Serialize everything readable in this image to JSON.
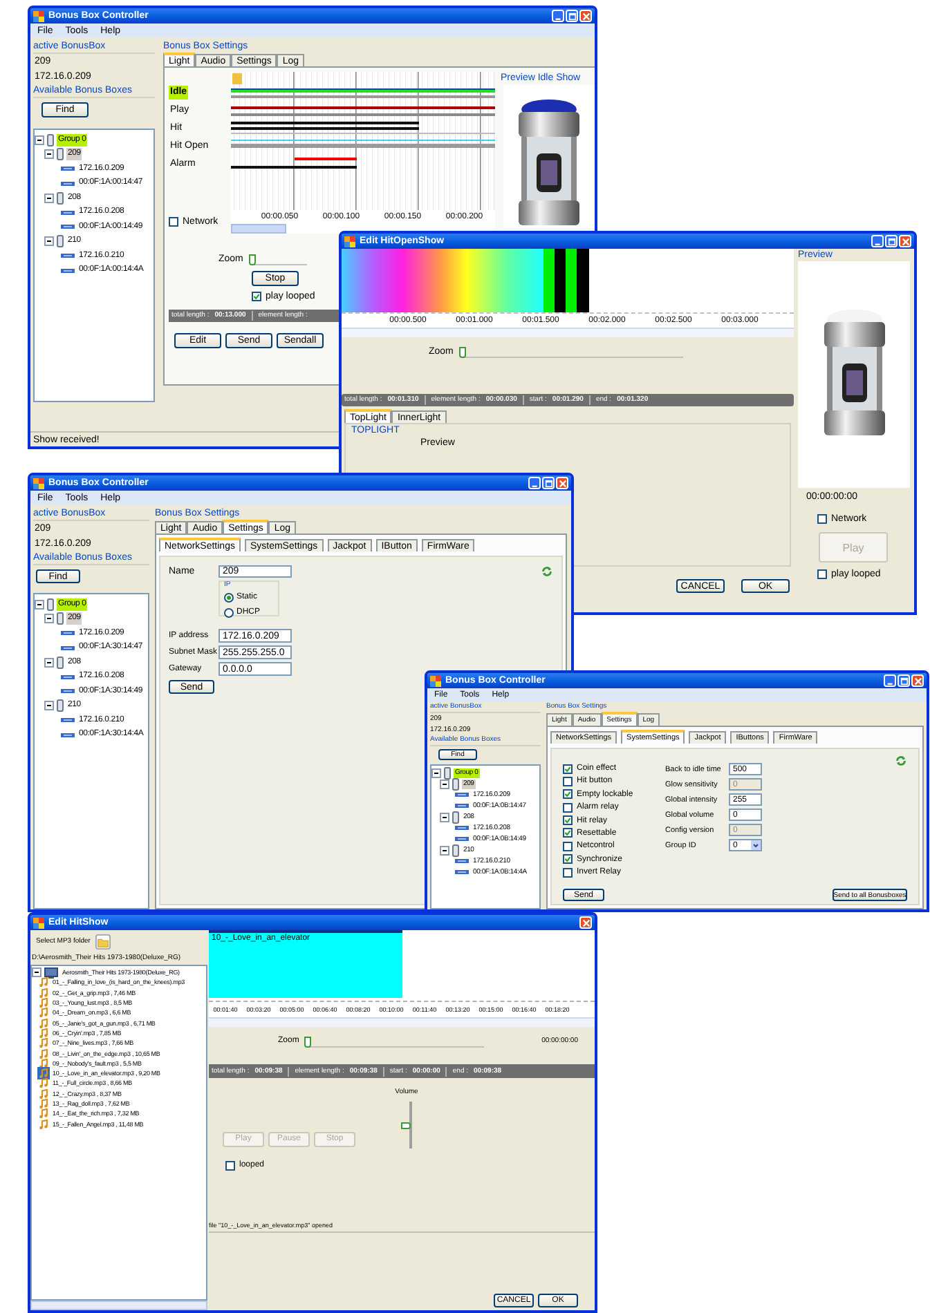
{
  "window_1": {
    "title": "Bonus Box Controller",
    "can_minimize": true,
    "menu": [
      "File",
      "Tools",
      "Help"
    ],
    "active_label": "active BonusBox",
    "active_name": "209",
    "active_ip": "172.16.0.209",
    "boxes_label": "Available Bonus Boxes",
    "find_button": "Find",
    "tree": [
      {
        "label": "Group 0",
        "kind": "group",
        "expanded": true,
        "highlighted": true,
        "children": [
          {
            "label": "209",
            "kind": "box",
            "expanded": true,
            "selected": true,
            "children": [
              {
                "label": "172.16.0.209"
              },
              {
                "label": "00:0F:1A:00:14:47"
              }
            ]
          },
          {
            "label": "208",
            "kind": "box",
            "expanded": true,
            "selected": false,
            "children": [
              {
                "label": "172.16.0.208"
              },
              {
                "label": "00:0F:1A:00:14:49"
              }
            ]
          },
          {
            "label": "210",
            "kind": "box",
            "expanded": true,
            "selected": false,
            "children": [
              {
                "label": "172.16.0.210"
              },
              {
                "label": "00:0F:1A:00:14:4A"
              }
            ]
          }
        ]
      }
    ],
    "settings_label": "Bonus Box Settings",
    "tabs": [
      {
        "label": "Light",
        "selected": true
      },
      {
        "label": "Audio",
        "selected": false
      },
      {
        "label": "Settings",
        "selected": false
      },
      {
        "label": "Log",
        "selected": false
      }
    ],
    "tracks": [
      {
        "label": "Idle",
        "highlighted": true
      },
      {
        "label": "Play",
        "highlighted": false
      },
      {
        "label": "Hit",
        "highlighted": false
      },
      {
        "label": "Hit Open",
        "highlighted": false
      },
      {
        "label": "Alarm",
        "highlighted": false
      }
    ],
    "network": {
      "label": "Network",
      "checked": false
    },
    "ticks": [
      "00:00.050",
      "00:00.100",
      "00:00.150",
      "00:00.200"
    ],
    "zoom": {
      "label": "Zoom",
      "level": 0
    },
    "stop_button": "Stop",
    "play_looped": {
      "label": "play looped",
      "checked": true
    },
    "status_fields": [
      {
        "label": "total length :",
        "value": "00:13.000"
      },
      {
        "label": "element length :"
      }
    ],
    "buttons": [
      "Edit",
      "Send",
      "Sendall"
    ],
    "preview_label": "Preview Idle Show",
    "status_bar": "Show received!"
  },
  "window_2": {
    "title": "Edit HitOpenShow",
    "can_minimize": true,
    "ticks": [
      "00:00.500",
      "00:01.000",
      "00:01.500",
      "00:02.000",
      "00:02.500",
      "00:03.000"
    ],
    "zoom": {
      "label": "Zoom",
      "level": 0
    },
    "status_fields": [
      {
        "label": "total length :",
        "value": "00:01.310"
      },
      {
        "label": "element length :",
        "value": "00:00.030"
      },
      {
        "label": "start :",
        "value": "00:01.290"
      },
      {
        "label": "end :",
        "value": "00:01.320"
      }
    ],
    "tabs": [
      {
        "label": "TopLight",
        "selected": true
      },
      {
        "label": "InnerLight",
        "selected": false
      }
    ],
    "group_label": "TOPLIGHT",
    "group_preview": "Preview",
    "preview_label": "Preview",
    "time": "00:00:00:00",
    "network": {
      "label": "Network",
      "checked": false
    },
    "play_button": {
      "label": "Play",
      "disabled": true
    },
    "play_looped": {
      "label": "play looped",
      "checked": false
    },
    "buttons": [
      "CANCEL",
      "OK"
    ]
  },
  "window_3": {
    "title": "Bonus Box Controller",
    "can_minimize": true,
    "menu": [
      "File",
      "Tools",
      "Help"
    ],
    "active_label": "active BonusBox",
    "active_name": "209",
    "active_ip": "172.16.0.209",
    "boxes_label": "Available Bonus Boxes",
    "find_button": "Find",
    "tree": [
      {
        "label": "Group 0",
        "kind": "group",
        "expanded": true,
        "highlighted": true,
        "children": [
          {
            "label": "209",
            "kind": "box",
            "expanded": true,
            "selected": true,
            "children": [
              {
                "label": "172.16.0.209"
              },
              {
                "label": "00:0F:1A:30:14:47"
              }
            ]
          },
          {
            "label": "208",
            "kind": "box",
            "expanded": true,
            "selected": false,
            "children": [
              {
                "label": "172.16.0.208"
              },
              {
                "label": "00:0F:1A:30:14:49"
              }
            ]
          },
          {
            "label": "210",
            "kind": "box",
            "expanded": true,
            "selected": false,
            "children": [
              {
                "label": "172.16.0.210"
              },
              {
                "label": "00:0F:1A:30:14:4A"
              }
            ]
          }
        ]
      }
    ],
    "settings_label": "Bonus Box Settings",
    "tabs": [
      {
        "label": "Light",
        "selected": false
      },
      {
        "label": "Audio",
        "selected": false
      },
      {
        "label": "Settings",
        "selected": true
      },
      {
        "label": "Log",
        "selected": false
      }
    ],
    "subtabs": [
      {
        "label": "NetworkSettings",
        "selected": true
      },
      {
        "label": "SystemSettings",
        "selected": false
      },
      {
        "label": "Jackpot",
        "selected": false
      },
      {
        "label": "IButton",
        "selected": false
      },
      {
        "label": "FirmWare",
        "selected": false
      }
    ],
    "name": {
      "label": "Name",
      "value": "209"
    },
    "ip_mode": {
      "label": "IP",
      "options": [
        {
          "label": "Static",
          "selected": true
        },
        {
          "label": "DHCP",
          "selected": false
        }
      ]
    },
    "addresses": [
      {
        "label": "IP address",
        "value": "172.16.0.209"
      },
      {
        "label": "Subnet Mask",
        "value": "255.255.255.0"
      },
      {
        "label": "Gateway",
        "value": "0.0.0.0"
      }
    ],
    "send_button": "Send"
  },
  "window_4": {
    "title": "Bonus Box Controller",
    "can_minimize": true,
    "menu": [
      "File",
      "Tools",
      "Help"
    ],
    "active_label": "active BonusBox",
    "active_name": "209",
    "active_ip": "172.16.0.209",
    "boxes_label": "Available Bonus Boxes",
    "find_button": "Find",
    "tree": [
      {
        "label": "Group 0",
        "kind": "group",
        "expanded": true,
        "highlighted": true,
        "children": [
          {
            "label": "209",
            "kind": "box",
            "expanded": true,
            "selected": true,
            "children": [
              {
                "label": "172.16.0.209"
              },
              {
                "label": "00:0F:1A:0B:14:47"
              }
            ]
          },
          {
            "label": "208",
            "kind": "box",
            "expanded": true,
            "selected": false,
            "children": [
              {
                "label": "172.16.0.208"
              },
              {
                "label": "00:0F:1A:0B:14:49"
              }
            ]
          },
          {
            "label": "210",
            "kind": "box",
            "expanded": true,
            "selected": false,
            "children": [
              {
                "label": "172.16.0.210"
              },
              {
                "label": "00:0F:1A:0B:14:4A"
              }
            ]
          }
        ]
      }
    ],
    "settings_label": "Bonus Box Settings",
    "tabs": [
      {
        "label": "Light",
        "selected": false
      },
      {
        "label": "Audio",
        "selected": false
      },
      {
        "label": "Settings",
        "selected": true
      },
      {
        "label": "Log",
        "selected": false
      }
    ],
    "subtabs": [
      {
        "label": "NetworkSettings",
        "selected": false
      },
      {
        "label": "SystemSettings",
        "selected": true
      },
      {
        "label": "Jackpot",
        "selected": false
      },
      {
        "label": "IButtons",
        "selected": false
      },
      {
        "label": "FirmWare",
        "selected": false
      }
    ],
    "options": [
      {
        "label": "Coin effect",
        "checked": true
      },
      {
        "label": "Hit button",
        "checked": false
      },
      {
        "label": "Empty lockable",
        "checked": true
      },
      {
        "label": "Alarm relay",
        "checked": false
      },
      {
        "label": "Hit relay",
        "checked": true
      },
      {
        "label": "Resettable",
        "checked": true
      },
      {
        "label": "Netcontrol",
        "checked": false
      },
      {
        "label": "Synchronize",
        "checked": true
      },
      {
        "label": "Invert Relay",
        "checked": false
      }
    ],
    "fields": [
      {
        "label": "Back to idle time",
        "value": "500",
        "kind": "text",
        "disabled": false
      },
      {
        "label": "Glow sensitivity",
        "value": "0",
        "kind": "text",
        "disabled": true
      },
      {
        "label": "Global intensity",
        "value": "255",
        "kind": "text",
        "disabled": false
      },
      {
        "label": "Global volume",
        "value": "0",
        "kind": "text",
        "disabled": false
      },
      {
        "label": "Config version",
        "value": "0",
        "kind": "text",
        "disabled": true
      },
      {
        "label": "Group ID",
        "value": "0",
        "kind": "dropdown",
        "disabled": false
      }
    ],
    "send_button": "Send",
    "send_all_button": "Send to all Bonusboxes"
  },
  "window_5": {
    "title": "Edit HitShow",
    "can_minimize": false,
    "folder_label": "Select MP3 folder",
    "path": "D:\\Aerosmith_Their Hits 1973-1980(Deluxe_RG)",
    "tree": [
      {
        "label": "Aerosmith_Their Hits 1973-1980(Deluxe_RG)",
        "kind": "album",
        "expanded": true,
        "children": [
          {
            "label": "01_-_Falling_in_love_(is_hard_on_the_knees).mp3",
            "kind": "track",
            "selected": false
          },
          {
            "label": "02_-_Get_a_grip.mp3 , 7,46 MB",
            "kind": "track",
            "selected": false
          },
          {
            "label": "03_-_Young_lust.mp3 , 8,5 MB",
            "kind": "track",
            "selected": false
          },
          {
            "label": "04_-_Dream_on.mp3 , 6,6 MB",
            "kind": "track",
            "selected": false
          },
          {
            "label": "05_-_Janie's_got_a_gun.mp3 , 6,71 MB",
            "kind": "track",
            "selected": false
          },
          {
            "label": "06_-_Cryin'.mp3 , 7,85 MB",
            "kind": "track",
            "selected": false
          },
          {
            "label": "07_-_Nine_lives.mp3 , 7,66 MB",
            "kind": "track",
            "selected": false
          },
          {
            "label": "08_-_Livin'_on_the_edge.mp3 , 10,65 MB",
            "kind": "track",
            "selected": false
          },
          {
            "label": "09_-_Nobody's_fault.mp3 , 5,5 MB",
            "kind": "track",
            "selected": false
          },
          {
            "label": "10_-_Love_in_an_elevator.mp3 , 9,20 MB",
            "kind": "track",
            "selected": true
          },
          {
            "label": "11_-_Full_circle.mp3 , 8,66 MB",
            "kind": "track",
            "selected": false
          },
          {
            "label": "12_-_Crazy.mp3 , 8,37 MB",
            "kind": "track",
            "selected": false
          },
          {
            "label": "13_-_Rag_doll.mp3 , 7,62 MB",
            "kind": "track",
            "selected": false
          },
          {
            "label": "14_-_Eat_the_rich.mp3 , 7,32 MB",
            "kind": "track",
            "selected": false
          },
          {
            "label": "15_-_Fallen_Angel.mp3 , 11,48 MB",
            "kind": "track",
            "selected": false
          }
        ]
      }
    ],
    "clip": "10_-_Love_in_an_elevator",
    "ticks": [
      "00:01:40",
      "00:03:20",
      "00:05:00",
      "00:06:40",
      "00:08:20",
      "00:10:00",
      "00:11:40",
      "00:13:20",
      "00:15:00",
      "00:16:40",
      "00:18:20"
    ],
    "zoom": {
      "label": "Zoom",
      "level": 0
    },
    "time": "00:00:00:00",
    "status_fields": [
      {
        "label": "total length :",
        "value": "00:09:38"
      },
      {
        "label": "element length :",
        "value": "00:09:38"
      },
      {
        "label": "start :",
        "value": "00:00:00"
      },
      {
        "label": "end :",
        "value": "00:09:38"
      }
    ],
    "volume": {
      "label": "Volume",
      "level": 0.5
    },
    "transport": [
      {
        "label": "Play",
        "disabled": true
      },
      {
        "label": "Pause",
        "disabled": true
      },
      {
        "label": "Stop",
        "disabled": true
      }
    ],
    "looped": {
      "label": "looped",
      "checked": false
    },
    "message": "file \"10_-_Love_in_an_elevator.mp3\" opened",
    "buttons": [
      "CANCEL",
      "OK"
    ]
  }
}
